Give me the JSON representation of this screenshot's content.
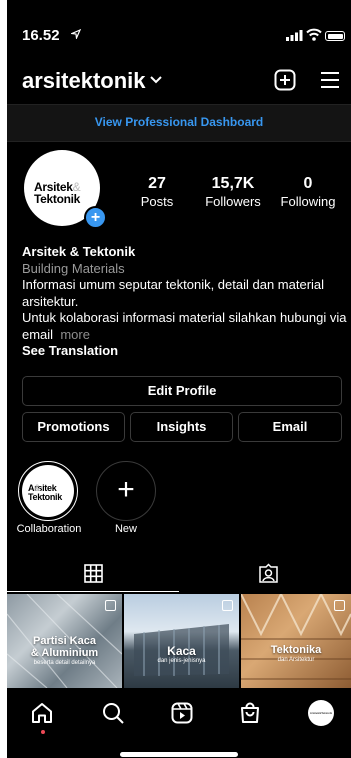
{
  "status": {
    "time": "16.52",
    "location_icon": "location-arrow-icon",
    "signal_icon": "signal-icon",
    "wifi_icon": "wifi-icon",
    "battery_icon": "battery-icon"
  },
  "header": {
    "username": "arsitektonik",
    "add_icon": "plus-square-icon",
    "menu_icon": "hamburger-menu-icon"
  },
  "pro_dashboard": "View Professional Dashboard",
  "profile": {
    "avatar_line1": "Arsitek",
    "avatar_line2": "Tektonik",
    "avatar_amp": "&"
  },
  "stats": [
    {
      "value": "27",
      "label": "Posts"
    },
    {
      "value": "15,7K",
      "label": "Followers"
    },
    {
      "value": "0",
      "label": "Following"
    }
  ],
  "bio": {
    "name": "Arsitek & Tektonik",
    "category": "Building Materials",
    "line1": "Informasi umum seputar tektonik, detail dan material arsitektur.",
    "line2": "Untuk kolaborasi informasi material silahkan hubungi via email",
    "more": "more",
    "see_translation": "See Translation"
  },
  "buttons": {
    "edit_profile": "Edit Profile",
    "promotions": "Promotions",
    "insights": "Insights",
    "email": "Email"
  },
  "highlights": [
    {
      "label": "Collaboration"
    },
    {
      "label": "New"
    }
  ],
  "tabs": {
    "grid_icon": "grid-icon",
    "tagged_icon": "tagged-icon"
  },
  "posts": [
    {
      "title1": "Partisi Kaca",
      "title2": "& Aluminium",
      "subtitle": "beserta detail detailnya"
    },
    {
      "title1": "Kaca",
      "title2": "",
      "subtitle": "dan jenis-jenisnya"
    },
    {
      "title1": "Tektonika",
      "title2": "",
      "subtitle": "dan Arsitektur"
    }
  ],
  "nav": [
    "home-icon",
    "search-icon",
    "reels-icon",
    "shop-icon",
    "profile-avatar"
  ],
  "colors": {
    "accent": "#3897f0",
    "background": "#000000",
    "notification": "#ed4956"
  }
}
